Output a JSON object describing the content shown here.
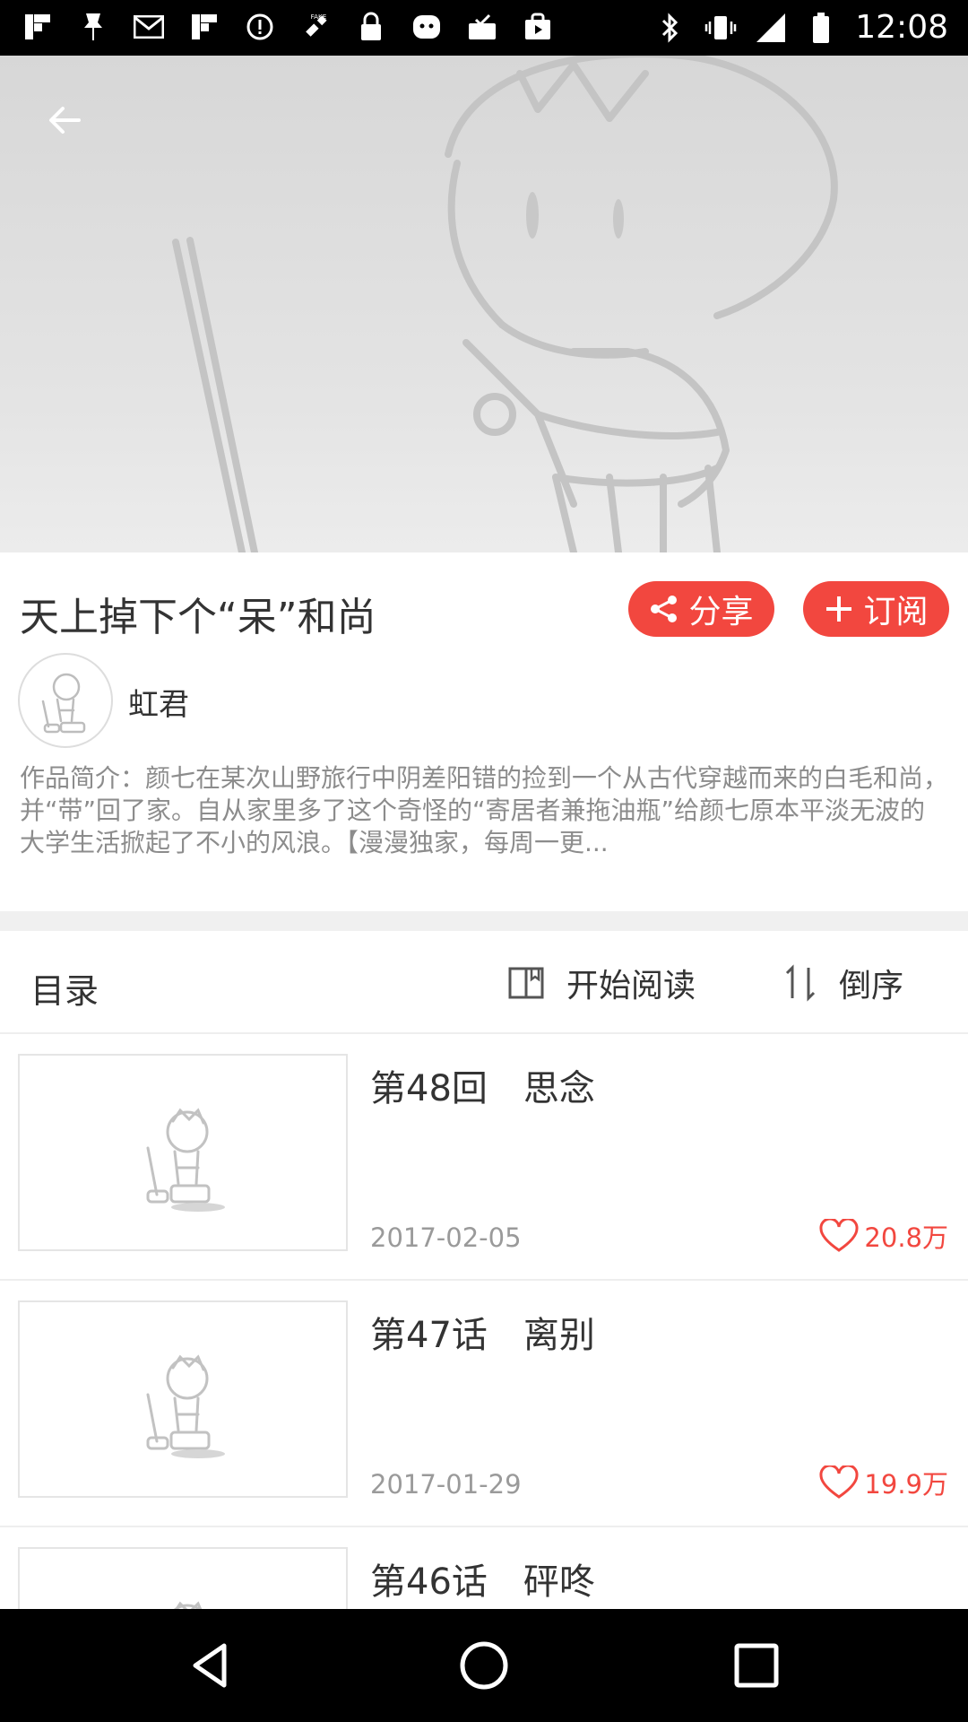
{
  "status_bar": {
    "time": "12:08",
    "fake_label": "FAKE"
  },
  "header": {
    "back_icon": "arrow-left-icon"
  },
  "comic": {
    "title": "天上掉下个“呆”和尚",
    "share_label": "分享",
    "subscribe_label": "订阅",
    "author": "虹君",
    "synopsis": "作品简介：颜七在某次山野旅行中阴差阳错的捡到一个从古代穿越而来的白毛和尚，并“带”回了家。自从家里多了这个奇怪的“寄居者兼拖油瓶”给颜七原本平淡无波的大学生活掀起了不小的风浪。【漫漫独家，每周一更..."
  },
  "toolbar": {
    "toc_label": "目录",
    "start_reading_label": "开始阅读",
    "reverse_label": "倒序"
  },
  "chapters": [
    {
      "title": "第48回　思念",
      "date": "2017-02-05",
      "likes": "20.8万"
    },
    {
      "title": "第47话　离别",
      "date": "2017-01-29",
      "likes": "19.9万"
    },
    {
      "title": "第46话　砰咚",
      "date": "",
      "likes": ""
    }
  ],
  "colors": {
    "accent": "#f2473f",
    "text": "#333333",
    "muted": "#8c8c8c"
  }
}
